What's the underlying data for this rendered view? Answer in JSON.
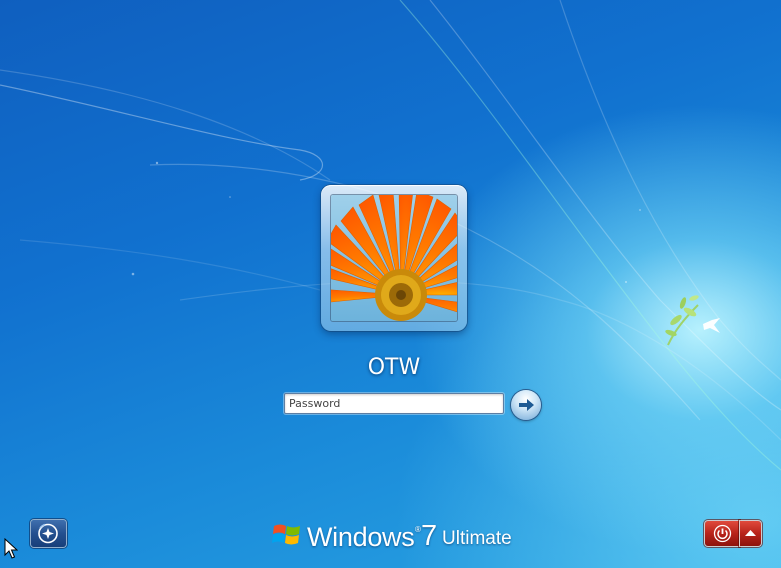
{
  "screen": "Windows logon",
  "user": {
    "name": "OTW",
    "picture_icon": "orange-gerbera-flower-picture"
  },
  "password": {
    "placeholder": "Password",
    "value": ""
  },
  "submit_icon": "arrow-right-icon",
  "ease_of_access_icon": "ease-of-access-icon",
  "branding": {
    "product": "Windows",
    "trademark": "®",
    "version": "7",
    "edition": "Ultimate"
  },
  "power": {
    "icon": "power-icon",
    "menu_icon": "chevron-up-icon",
    "color": "#c0271d"
  },
  "colors": {
    "background_dark": "#0f5fbf",
    "background_light": "#2aa5e3"
  }
}
